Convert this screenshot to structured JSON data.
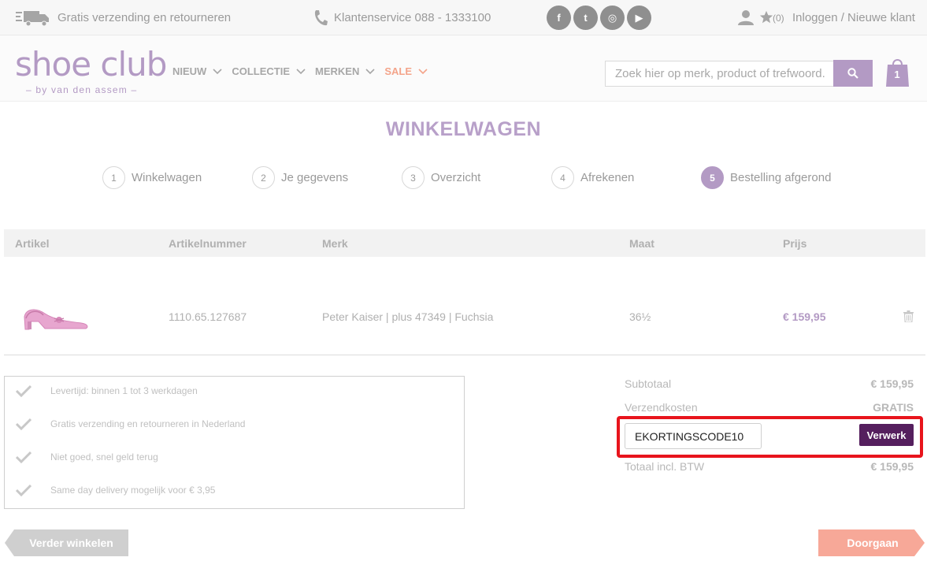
{
  "topbar": {
    "shipping": "Gratis verzending en retourneren",
    "customer_service": "Klantenservice 088 - 1333100",
    "socials": [
      {
        "name": "facebook-icon",
        "glyph": "f"
      },
      {
        "name": "twitter-icon",
        "glyph": "t"
      },
      {
        "name": "instagram-icon",
        "glyph": "◎"
      },
      {
        "name": "youtube-icon",
        "glyph": "▶"
      }
    ],
    "favorites_count": "(0)",
    "login": "Inloggen / Nieuwe klant"
  },
  "header": {
    "logo": "shoe club",
    "tagline": "– by van den assem –",
    "nav": [
      "NIEUW",
      "COLLECTIE",
      "MERKEN",
      "SALE"
    ],
    "search_placeholder": "Zoek hier op merk, product of trefwoord.",
    "cart_count": "1"
  },
  "page": {
    "title": "WINKELWAGEN",
    "steps": [
      {
        "num": "1",
        "label": "Winkelwagen"
      },
      {
        "num": "2",
        "label": "Je gegevens"
      },
      {
        "num": "3",
        "label": "Overzicht"
      },
      {
        "num": "4",
        "label": "Afrekenen"
      },
      {
        "num": "5",
        "label": "Bestelling afgerond"
      }
    ]
  },
  "table": {
    "headers": [
      "Artikel",
      "Artikelnummer",
      "Merk",
      "Maat",
      "Prijs"
    ],
    "rows": [
      {
        "article_number": "1110.65.127687",
        "brand": "Peter Kaiser | plus 47349 | Fuchsia",
        "size": "36½",
        "price": "€ 159,95"
      }
    ]
  },
  "usps": [
    "Levertijd: binnen 1 tot 3 werkdagen",
    "Gratis verzending en retourneren in Nederland",
    "Niet goed, snel geld terug",
    "Same day delivery mogelijk voor € 3,95"
  ],
  "totals": {
    "subtotal_label": "Subtotaal",
    "subtotal_value": "€ 159,95",
    "shipping_label": "Verzendkosten",
    "shipping_value": "GRATIS",
    "promo_code": "EKORTINGSCODE10",
    "promo_button": "Verwerk",
    "total_label": "Totaal incl. BTW",
    "total_value": "€ 159,95"
  },
  "buttons": {
    "back": "Verder winkelen",
    "next": "Doorgaan"
  },
  "colors": {
    "brand": "#b39ac4",
    "sale": "#f4a48a",
    "promo_button": "#551f5e",
    "highlight": "#e8141c",
    "next_button": "#f7a898"
  }
}
